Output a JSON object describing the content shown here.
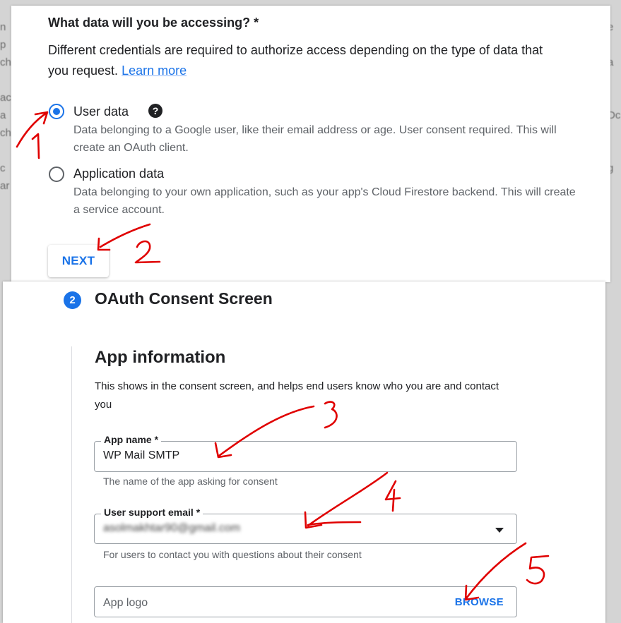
{
  "question": {
    "title": "What data will you be accessing? *",
    "description": "Different credentials are required to authorize access depending on the type of data that you request.",
    "learn_more": "Learn more"
  },
  "options": [
    {
      "label": "User data",
      "help": "Data belonging to a Google user, like their email address or age. User consent required. This will create an OAuth client.",
      "selected": true
    },
    {
      "label": "Application data",
      "help": "Data belonging to your own application, such as your app's Cloud Firestore backend. This will create a service account.",
      "selected": false
    }
  ],
  "next_button": "NEXT",
  "step": {
    "number": "2",
    "title": "OAuth Consent Screen"
  },
  "app_information": {
    "title": "App information",
    "description": "This shows in the consent screen, and helps end users know who you are and contact you"
  },
  "fields": {
    "app_name": {
      "label": "App name *",
      "value": "WP Mail SMTP",
      "hint": "The name of the app asking for consent"
    },
    "support_email": {
      "label": "User support email *",
      "value": "asolmakhtar90@gmail.com",
      "hint": "For users to contact you with questions about their consent"
    },
    "app_logo": {
      "placeholder": "App logo",
      "browse": "BROWSE"
    }
  },
  "colors": {
    "accent": "#1a73e8",
    "annotation": "#e00000"
  }
}
